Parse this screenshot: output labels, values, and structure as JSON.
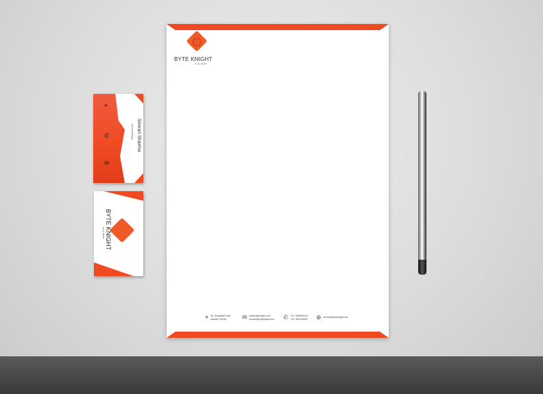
{
  "letterhead": {
    "brand": "BYTE KNIGHT",
    "tagline": "we try harder",
    "footer": {
      "address": [
        "46, Golaghata road",
        "kolkata 700048"
      ],
      "web": [
        "www.byteknight.com",
        "simran@byteknight.com"
      ],
      "phone": [
        "+91 7856932141",
        "+91 7852148387"
      ],
      "email": "simran@byteknight.com"
    }
  },
  "business_card_back": {
    "name": "Simran Sharma",
    "title": "General Manager"
  },
  "business_card_front": {
    "brand": "BYTE KNIGHT",
    "tagline": "we try harder"
  },
  "colors": {
    "accent": "#f04a23",
    "floor": "#3a3a3a"
  },
  "icons": [
    "location-icon",
    "mail-icon",
    "phone-icon",
    "globe-icon"
  ]
}
